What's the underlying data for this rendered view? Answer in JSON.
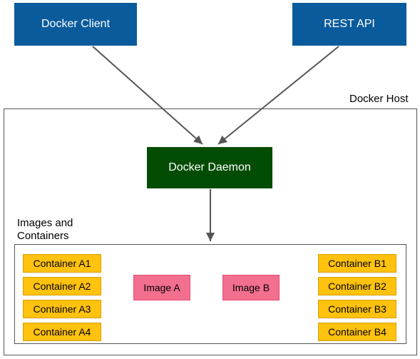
{
  "top": {
    "client": "Docker Client",
    "rest_api": "REST API"
  },
  "host_label": "Docker Host",
  "daemon": "Docker Daemon",
  "images_label_line1": "Images and",
  "images_label_line2": "Containers",
  "containers_left": [
    "Container A1",
    "Container A2",
    "Container A3",
    "Container A4"
  ],
  "containers_right": [
    "Container B1",
    "Container B2",
    "Container B3",
    "Container B4"
  ],
  "images": [
    "Image A",
    "Image B"
  ],
  "colors": {
    "blue": "#0a5b9c",
    "green": "#034c03",
    "yellow": "#ffc20e",
    "pink": "#f36f8f"
  }
}
